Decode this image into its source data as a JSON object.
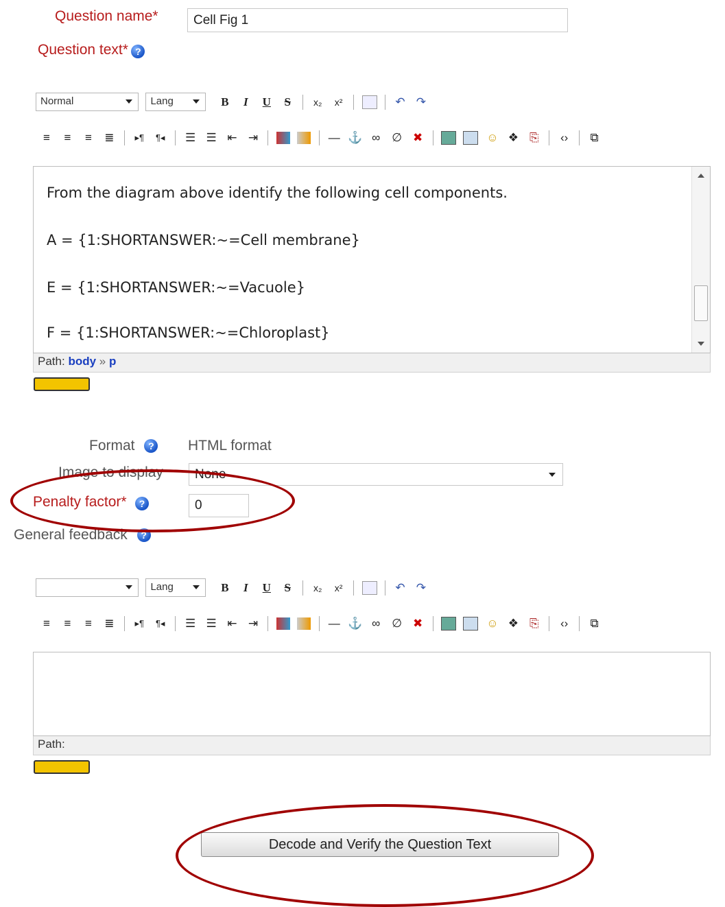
{
  "question_name": {
    "label": "Question name*",
    "value": "Cell Fig 1"
  },
  "question_text": {
    "label": "Question text*",
    "toolbar": {
      "format_select": "Normal",
      "lang_select": "Lang",
      "bold": "B",
      "italic": "I",
      "underline": "U",
      "strike": "S",
      "subscript": "x₂",
      "superscript": "x²",
      "undo": "↶",
      "redo": "↷"
    },
    "content": [
      "From the diagram above identify the following cell components.",
      "A = {1:SHORTANSWER:~=Cell membrane}",
      "E = {1:SHORTANSWER:~=Vacuole}",
      "F = {1:SHORTANSWER:~=Chloroplast}"
    ],
    "path_label": "Path:",
    "path_body": "body",
    "path_sep": "»",
    "path_p": "p"
  },
  "format": {
    "label": "Format",
    "value": "HTML format"
  },
  "image_to_display": {
    "label": "Image to display",
    "value": "None"
  },
  "penalty_factor": {
    "label": "Penalty factor*",
    "value": "0"
  },
  "general_feedback": {
    "label": "General feedback",
    "toolbar": {
      "format_select": "",
      "lang_select": "Lang"
    },
    "path_label": "Path:"
  },
  "decode_button": "Decode and Verify the Question Text",
  "colors": {
    "required_label": "#b71c1c",
    "annotation": "#a00000",
    "path_link": "#1a3fc0"
  }
}
